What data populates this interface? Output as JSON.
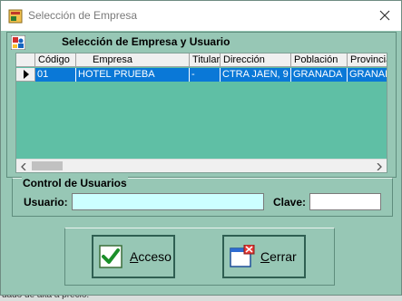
{
  "window": {
    "title": "Selección de Empresa"
  },
  "panel": {
    "title": "Selección de Empresa y Usuario"
  },
  "grid": {
    "columns": [
      "Código",
      "Empresa",
      "Titular",
      "Dirección",
      "Población",
      "Provincia"
    ],
    "rows": [
      [
        "01",
        "HOTEL PRUEBA",
        "-",
        "CTRA JAEN, 9",
        "GRANADA",
        "GRANADA"
      ]
    ],
    "selected_color": "#0a78d7"
  },
  "users": {
    "title": "Control de Usuarios",
    "usuario_label": "Usuario:",
    "usuario_value": "",
    "clave_label": "Clave:",
    "clave_value": ""
  },
  "buttons": {
    "acceso": "Acceso",
    "cerrar": "Cerrar"
  },
  "background": {
    "status_text": "dado de alta a precio."
  },
  "icons": {
    "window": "app-icon",
    "panel": "company-user-icon",
    "acceso": "check-icon",
    "cerrar": "window-close-icon"
  }
}
